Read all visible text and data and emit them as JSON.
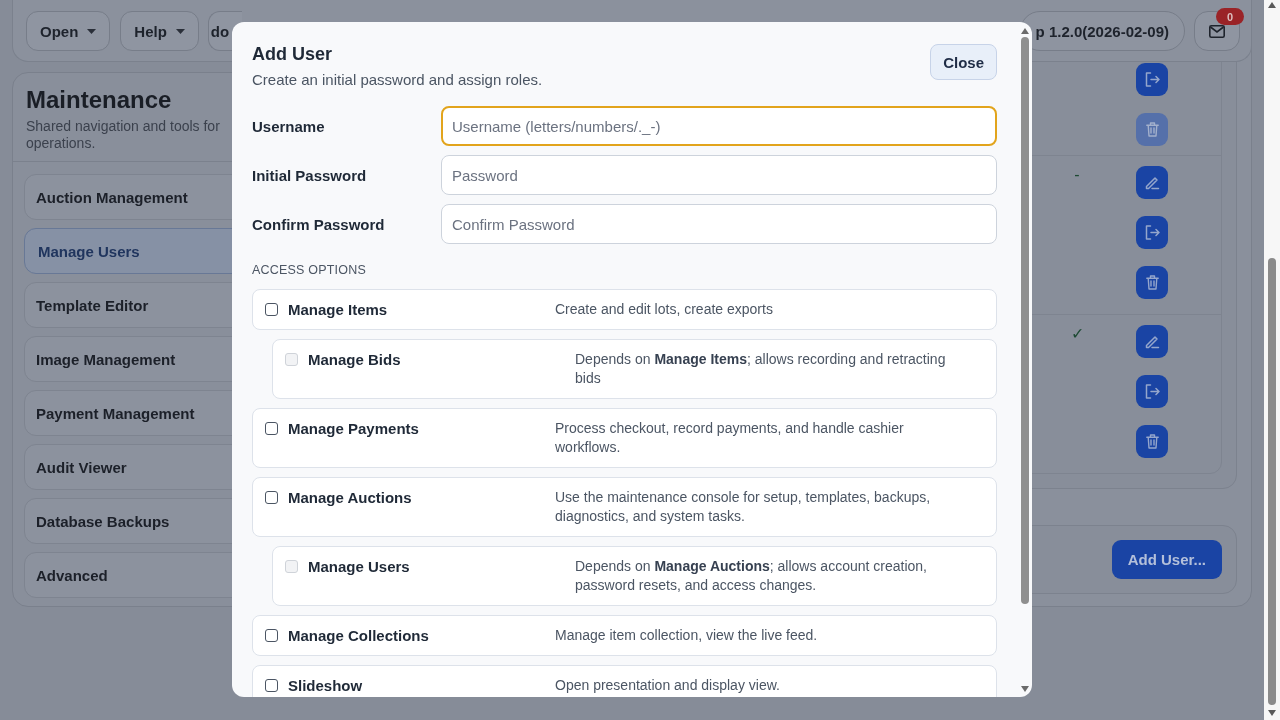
{
  "top_bar": {
    "menus": [
      {
        "label": "Open",
        "dropdown": true
      },
      {
        "label": "Help",
        "dropdown": true
      },
      {
        "label": "do",
        "dropdown": false
      }
    ],
    "version": "p 1.2.0(2026-02-09)",
    "notifications": "0"
  },
  "sidebar": {
    "title": "Maintenance",
    "subtitle": "Shared navigation and tools for operations.",
    "items": [
      {
        "label": "Auction Management",
        "selected": false
      },
      {
        "label": "Manage Users",
        "selected": true
      },
      {
        "label": "Template Editor",
        "selected": false
      },
      {
        "label": "Image Management",
        "selected": false
      },
      {
        "label": "Payment Management",
        "selected": false
      },
      {
        "label": "Audit Viewer",
        "selected": false
      },
      {
        "label": "Database Backups",
        "selected": false
      },
      {
        "label": "Advanced",
        "selected": false
      }
    ]
  },
  "users_table": {
    "rows": [
      {
        "actions": [
          {
            "kind": "logout",
            "disabled": false
          },
          {
            "kind": "delete",
            "disabled": true
          }
        ]
      },
      {
        "column_1": "-",
        "actions": [
          {
            "kind": "edit",
            "disabled": false
          },
          {
            "kind": "logout",
            "disabled": false
          },
          {
            "kind": "delete",
            "disabled": false
          }
        ]
      },
      {
        "column_1": "✓",
        "actions": [
          {
            "kind": "edit",
            "disabled": false
          },
          {
            "kind": "logout",
            "disabled": false
          },
          {
            "kind": "delete",
            "disabled": false
          }
        ]
      }
    ]
  },
  "add_user_button": "Add User...",
  "dialog": {
    "title": "Add User",
    "subtitle": "Create an initial password and assign roles.",
    "close_button": "Close",
    "fields": [
      {
        "label": "Username",
        "placeholder": "Username (letters/numbers/._-)",
        "focused": true
      },
      {
        "label": "Initial Password",
        "placeholder": "Password",
        "focused": false
      },
      {
        "label": "Confirm Password",
        "placeholder": "Confirm Password",
        "focused": false
      }
    ],
    "section_title": "ACCESS OPTIONS",
    "options": [
      {
        "label": "Manage Items",
        "description": "Create and edit lots, create exports",
        "checked": false,
        "disabled": false,
        "children": [
          {
            "label": "Manage Bids",
            "description": "Depends on **Manage Items**; allows recording and retracting bids",
            "checked": false,
            "disabled": true
          }
        ]
      },
      {
        "label": "Manage Payments",
        "description": "Process checkout, record payments, and handle cashier workflows.",
        "checked": false,
        "disabled": false
      },
      {
        "label": "Manage Auctions",
        "description": "Use the maintenance console for setup, templates, backups, diagnostics, and system tasks.",
        "checked": false,
        "disabled": false,
        "children": [
          {
            "label": "Manage Users",
            "description": "Depends on **Manage Auctions**; allows account creation, password resets, and access changes.",
            "checked": false,
            "disabled": true
          }
        ]
      },
      {
        "label": "Manage Collections",
        "description": "Manage item collection, view the live feed.",
        "checked": false,
        "disabled": false
      },
      {
        "label": "Slideshow",
        "description": "Open presentation and display view.",
        "checked": false,
        "disabled": false
      }
    ]
  }
}
